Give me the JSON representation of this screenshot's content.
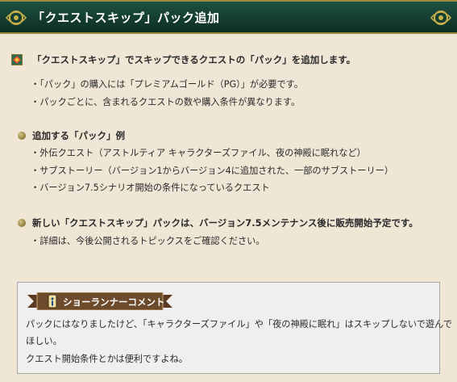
{
  "header": {
    "title": "「クエストスキップ」パック追加"
  },
  "lead": "「クエストスキップ」でスキップできるクエストの「パック」を追加します。",
  "lead_bullets": [
    "・「パック」の購入には「プレミアムゴールド（PG）」が必要です。",
    "・パックごとに、含まれるクエストの数や購入条件が異なります。"
  ],
  "section1": {
    "title": "追加する「パック」例",
    "items": [
      "・外伝クエスト（アストルティア キャラクターズファイル、夜の神殿に眠れなど）",
      "・サブストーリー（バージョン1からバージョン4に追加された、一部のサブストーリー）",
      "・バージョン7.5シナリオ開始の条件になっているクエスト"
    ]
  },
  "section2": {
    "title": "新しい「クエストスキップ」パックは、バージョン7.5メンテナンス後に販売開始予定です。",
    "items": [
      "・詳細は、今後公開されるトピックスをご確認ください。"
    ]
  },
  "comment": {
    "tag": "ショーランナーコメント",
    "lines": [
      "パックにはなりましたけど、「キャラクターズファイル」や「夜の神殿に眠れ」はスキップしないで遊んで",
      "ほしい。",
      "クエスト開始条件とかは便利ですよね。"
    ]
  }
}
